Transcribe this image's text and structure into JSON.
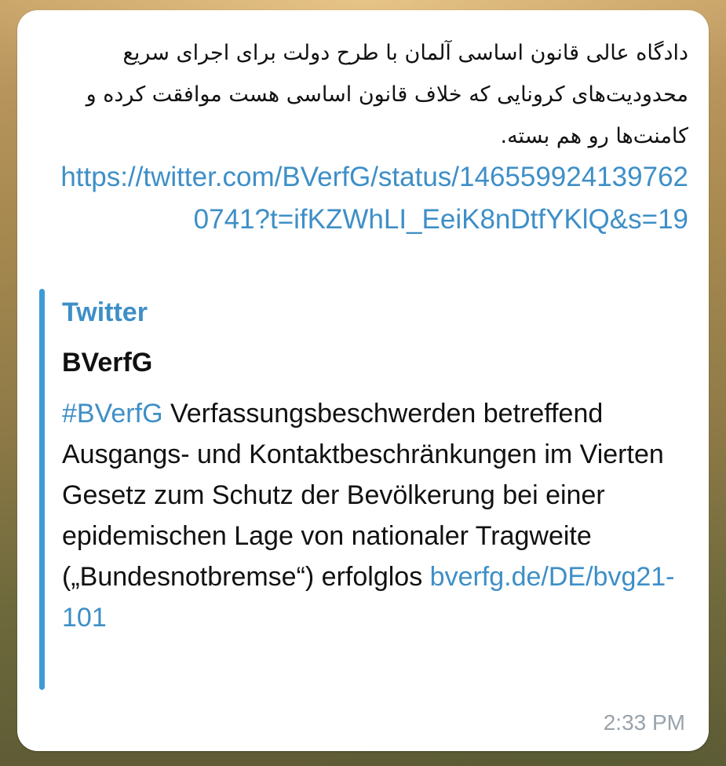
{
  "message": {
    "text_fa": "دادگاه عالی قانون اساسی آلمان با طرح دولت برای اجرای سریع محدودیت‌های کرونایی که خلاف قانون اساسی هست موافقت کرده و کامنت‌ها رو هم بسته.",
    "link": "https://twitter.com/BVerfG/status/1465599241397620741?t=ifKZWhLI_EeiK8nDtfYKlQ&s=19",
    "time": "2:33 PM"
  },
  "link_preview": {
    "site_name": "Twitter",
    "title": "BVerfG",
    "hashtag": "#BVerfG",
    "description": " Verfassungsbeschwerden betreffend Ausgangs- und Kontaktbeschränkungen im Vierten Gesetz zum Schutz der Bevölkerung bei einer epidemischen Lage von nationaler Tragweite („Bundesnotbremse“) erfolglos ",
    "desc_link": "bverfg.de/DE/bvg21-101",
    "accent_color": "#3e9ad6"
  }
}
